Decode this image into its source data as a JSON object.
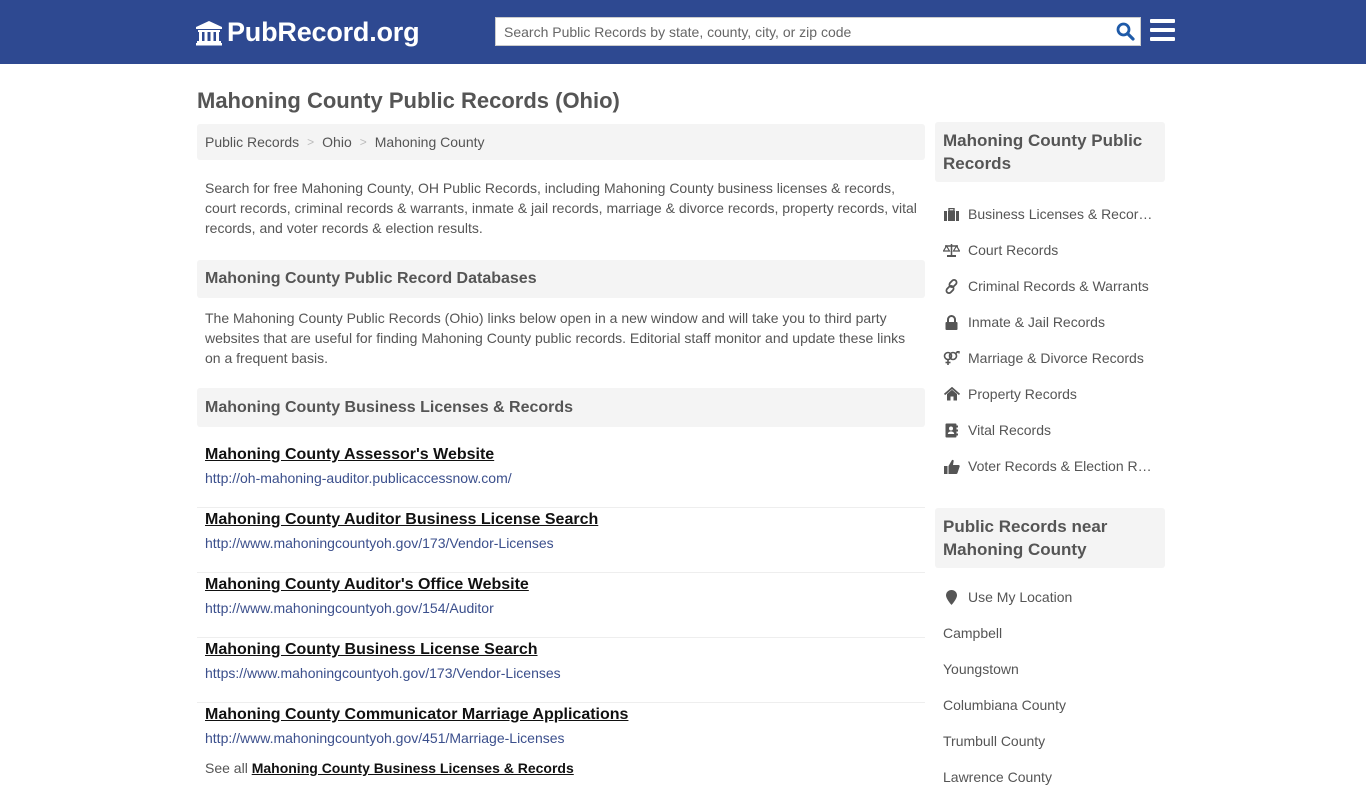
{
  "header": {
    "logo_text": "PubRecord.org",
    "search_placeholder": "Search Public Records by state, county, city, or zip code",
    "search_value": "",
    "brand_color": "#2e4991"
  },
  "page": {
    "title": "Mahoning County Public Records (Ohio)"
  },
  "breadcrumb": {
    "items": [
      {
        "label": "Public Records"
      },
      {
        "label": "Ohio"
      },
      {
        "label": "Mahoning County"
      }
    ],
    "separator": ">"
  },
  "intro": "Search for free Mahoning County, OH Public Records, including Mahoning County business licenses & records, court records, criminal records & warrants, inmate & jail records, marriage & divorce records, property records, vital records, and voter records & election results.",
  "databases_section": {
    "heading": "Mahoning County Public Record Databases",
    "description": "The Mahoning County Public Records (Ohio) links below open in a new window and will take you to third party websites that are useful for finding Mahoning County public records. Editorial staff monitor and update these links on a frequent basis."
  },
  "business_section": {
    "heading": "Mahoning County Business Licenses & Records",
    "links": [
      {
        "title": "Mahoning County Assessor's Website",
        "url": "http://oh-mahoning-auditor.publicaccessnow.com/"
      },
      {
        "title": "Mahoning County Auditor Business License Search",
        "url": "http://www.mahoningcountyoh.gov/173/Vendor-Licenses"
      },
      {
        "title": "Mahoning County Auditor's Office Website",
        "url": "http://www.mahoningcountyoh.gov/154/Auditor"
      },
      {
        "title": "Mahoning County Business License Search",
        "url": "https://www.mahoningcountyoh.gov/173/Vendor-Licenses"
      },
      {
        "title": "Mahoning County Communicator Marriage Applications",
        "url": "http://www.mahoningcountyoh.gov/451/Marriage-Licenses"
      }
    ],
    "see_all_prefix": "See all",
    "see_all_link": "Mahoning County Business Licenses & Records"
  },
  "sidebar": {
    "records_heading": "Mahoning County Public Records",
    "records": [
      {
        "label": "Business Licenses & Records",
        "icon": "briefcase-icon"
      },
      {
        "label": "Court Records",
        "icon": "balance-scale-icon"
      },
      {
        "label": "Criminal Records & Warrants",
        "icon": "link-icon"
      },
      {
        "label": "Inmate & Jail Records",
        "icon": "lock-icon"
      },
      {
        "label": "Marriage & Divorce Records",
        "icon": "venus-mars-icon"
      },
      {
        "label": "Property Records",
        "icon": "home-icon"
      },
      {
        "label": "Vital Records",
        "icon": "address-book-icon"
      },
      {
        "label": "Voter Records & Election Results",
        "icon": "thumbs-up-icon"
      }
    ],
    "near_heading": "Public Records near Mahoning County",
    "use_location": "Use My Location",
    "near": [
      {
        "label": "Campbell"
      },
      {
        "label": "Youngstown"
      },
      {
        "label": "Columbiana County"
      },
      {
        "label": "Trumbull County"
      },
      {
        "label": "Lawrence County"
      }
    ]
  }
}
